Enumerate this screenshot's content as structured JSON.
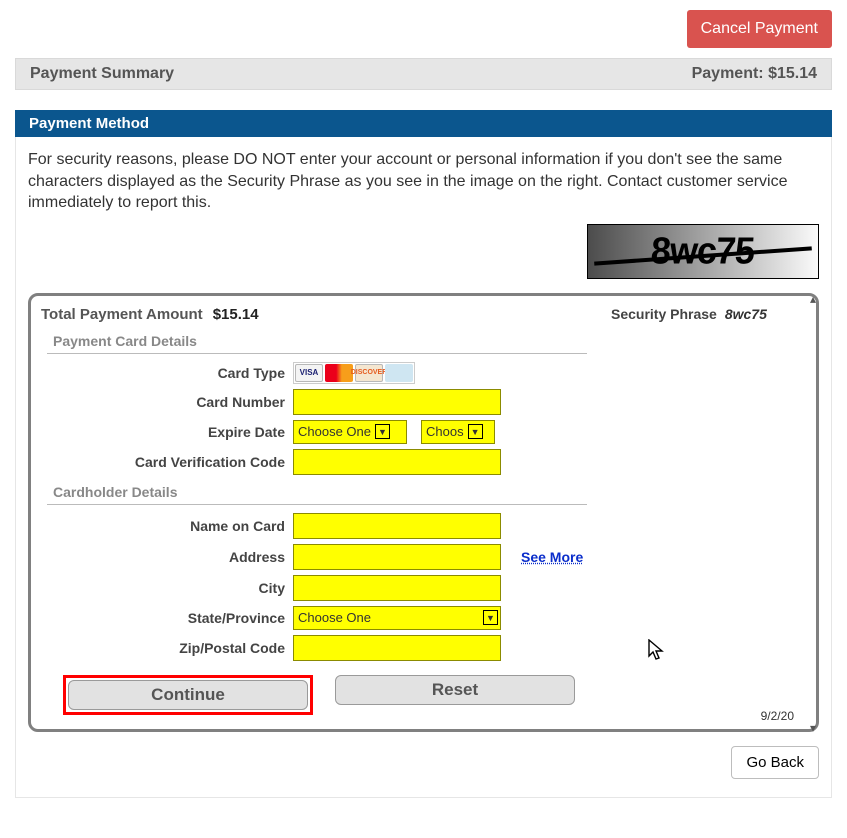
{
  "top": {
    "cancel": "Cancel Payment"
  },
  "summary": {
    "left": "Payment Summary",
    "right": "Payment: $15.14"
  },
  "method_header": "Payment Method",
  "security_msg": "For security reasons, please DO NOT enter your account or personal information if you don't see the same characters displayed as the Security Phrase as you see in the image on the right. Contact customer service immediately to report this.",
  "captcha": "8wc75",
  "panel": {
    "total_label": "Total Payment Amount",
    "total_value": "$15.14",
    "security_label": "Security Phrase",
    "security_value": "8wc75",
    "section_card": "Payment Card Details",
    "section_holder": "Cardholder Details",
    "labels": {
      "card_type": "Card Type",
      "card_number": "Card Number",
      "expire": "Expire Date",
      "cvc": "Card Verification Code",
      "name": "Name on Card",
      "address": "Address",
      "city": "City",
      "state": "State/Province",
      "zip": "Zip/Postal Code"
    },
    "choose_one": "Choose One",
    "choose_short": "Choos",
    "see_more": "See More",
    "continue": "Continue",
    "reset": "Reset",
    "date": "9/2/20",
    "card_brands": {
      "visa": "VISA",
      "mc": "",
      "disc": "DISCOVER",
      "amex": ""
    }
  },
  "go_back": "Go Back"
}
